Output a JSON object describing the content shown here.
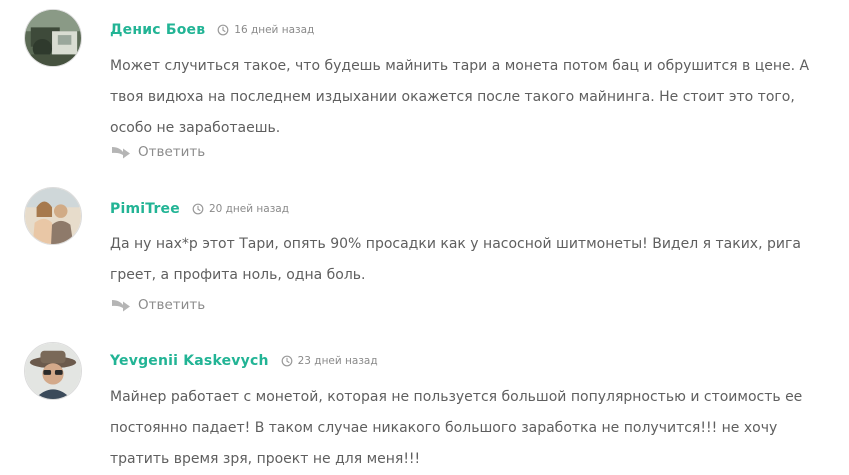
{
  "comments": [
    {
      "author": "Денис Боев",
      "date": "16 дней назад",
      "text": "Может случиться такое, что будешь майнить тари а монета потом бац и обрушится в цене. А твоя видюха на последнем издыхании окажется после такого майнинга. Не стоит это того, особо не заработаешь.",
      "reply_label": "Ответить"
    },
    {
      "author": "PimiTree",
      "date": "20 дней назад",
      "text": "Да ну нах*р этот Тари, опять 90% просадки как у насосной шитмонеты! Видел я таких, рига греет, а профита ноль, одна боль.",
      "reply_label": "Ответить"
    },
    {
      "author": "Yevgenii Kaskevych",
      "date": "23 дней назад",
      "text": "Майнер работает с монетой, которая не пользуется большой популярностью и стоимость ее постоянно падает! В таком случае никакого большого заработка не получится!!! не хочу тратить время зря, проект не для меня!!!"
    }
  ],
  "colors": {
    "author": "#22b495",
    "text": "#5f5f5f",
    "meta": "#8a8a8a",
    "reply_icon": "#b5b5b5"
  },
  "icons": {
    "date": "clock-icon",
    "reply": "reply-arrow-icon"
  }
}
